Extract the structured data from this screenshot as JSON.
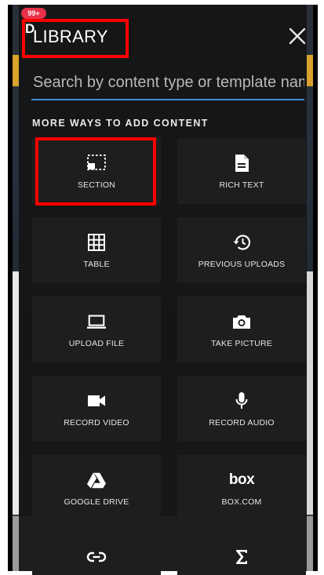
{
  "app": {
    "badge": "99+",
    "title": "LIBRARY",
    "badge_letter": "D"
  },
  "search": {
    "placeholder": "Search by content type or template name"
  },
  "section": {
    "label": "MORE WAYS TO ADD CONTENT"
  },
  "tiles": [
    {
      "label": "SECTION",
      "icon": "section-icon"
    },
    {
      "label": "RICH TEXT",
      "icon": "document-icon"
    },
    {
      "label": "TABLE",
      "icon": "table-icon"
    },
    {
      "label": "PREVIOUS UPLOADS",
      "icon": "history-icon"
    },
    {
      "label": "UPLOAD FILE",
      "icon": "laptop-icon"
    },
    {
      "label": "TAKE PICTURE",
      "icon": "camera-icon"
    },
    {
      "label": "RECORD VIDEO",
      "icon": "video-icon"
    },
    {
      "label": "RECORD AUDIO",
      "icon": "microphone-icon"
    },
    {
      "label": "GOOGLE DRIVE",
      "icon": "google-drive-icon"
    },
    {
      "label": "BOX.COM",
      "icon": "box-icon",
      "logo_text": "box"
    },
    {
      "label": "",
      "icon": "link-icon"
    },
    {
      "label": "",
      "icon": "sigma-icon"
    }
  ],
  "colors": {
    "highlight": "#ff0000",
    "search_underline": "#3f8ad8",
    "badge": "#e8324a"
  }
}
